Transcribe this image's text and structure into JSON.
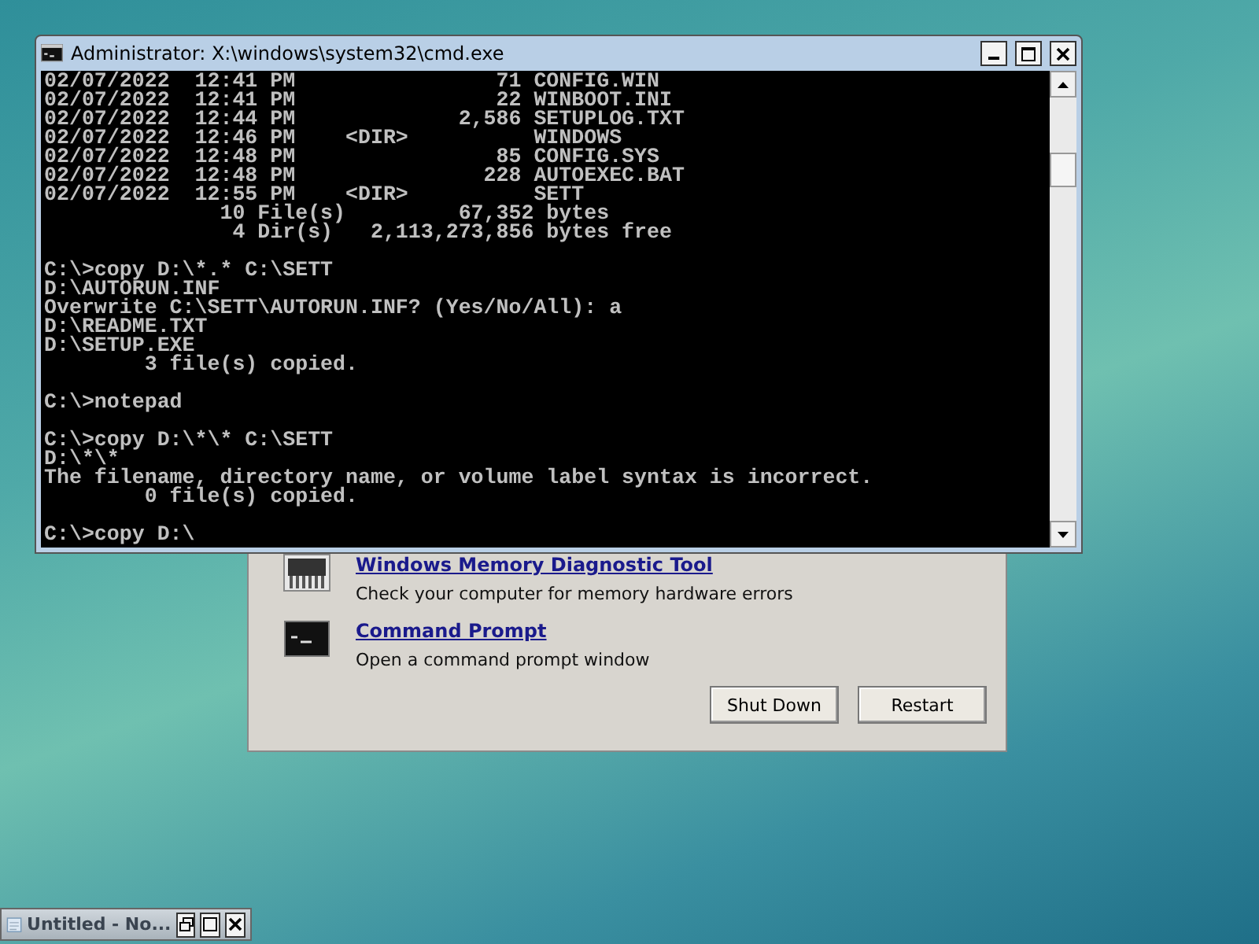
{
  "recovery_dialog": {
    "items": [
      {
        "title": "Windows Memory Diagnostic Tool",
        "description": "Check your computer for memory hardware errors",
        "kind": "memory"
      },
      {
        "title": "Command Prompt",
        "description": "Open a command prompt window",
        "kind": "console"
      }
    ],
    "buttons": [
      "Shut Down",
      "Restart"
    ]
  },
  "console_window": {
    "title": "Administrator: X:\\windows\\system32\\cmd.exe",
    "blocks": [
      [
        "02/07/2022  12:41 PM                71 CONFIG.WIN",
        "02/07/2022  12:41 PM                22 WINBOOT.INI",
        "02/07/2022  12:44 PM             2,586 SETUPLOG.TXT",
        "02/07/2022  12:46 PM    <DIR>          WINDOWS",
        "02/07/2022  12:48 PM                85 CONFIG.SYS",
        "02/07/2022  12:48 PM               228 AUTOEXEC.BAT",
        "02/07/2022  12:55 PM    <DIR>          SETT",
        "              10 File(s)         67,352 bytes",
        "               4 Dir(s)   2,113,273,856 bytes free"
      ],
      [
        "C:\\>copy D:\\*.* C:\\SETT",
        "D:\\AUTORUN.INF",
        "Overwrite C:\\SETT\\AUTORUN.INF? (Yes/No/All): a",
        "D:\\README.TXT",
        "D:\\SETUP.EXE",
        "        3 file(s) copied."
      ],
      [
        "C:\\>notepad"
      ],
      [
        "C:\\>copy D:\\*\\* C:\\SETT",
        "D:\\*\\*",
        "The filename, directory name, or volume label syntax is incorrect.",
        "        0 file(s) copied."
      ],
      [
        "C:\\>copy D:\\"
      ]
    ]
  },
  "minimized_window": {
    "title": "Untitled - No..."
  }
}
